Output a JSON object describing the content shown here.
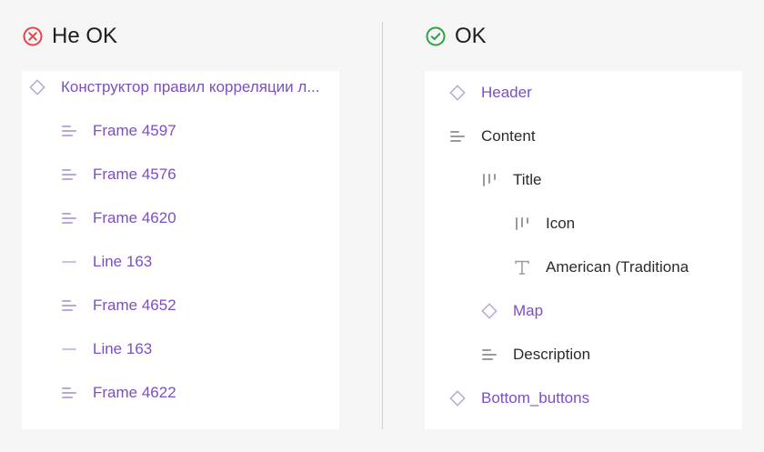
{
  "left": {
    "title": "Не OK",
    "status_color": "#e0474c",
    "items": [
      {
        "label": "Конструктор правил корреляции л...",
        "icon": "component-diamond-icon",
        "color": "purple"
      },
      {
        "label": "Frame 4597",
        "icon": "auto-layout-left-icon",
        "color": "purple"
      },
      {
        "label": "Frame 4576",
        "icon": "auto-layout-left-icon",
        "color": "purple"
      },
      {
        "label": "Frame 4620",
        "icon": "auto-layout-left-icon",
        "color": "purple"
      },
      {
        "label": "Line 163",
        "icon": "line-icon",
        "color": "purple"
      },
      {
        "label": "Frame 4652",
        "icon": "auto-layout-left-icon",
        "color": "purple"
      },
      {
        "label": "Line 163",
        "icon": "line-icon",
        "color": "purple"
      },
      {
        "label": "Frame 4622",
        "icon": "auto-layout-left-icon",
        "color": "purple"
      }
    ]
  },
  "right": {
    "title": "OK",
    "status_color": "#2fa043",
    "items": [
      {
        "label": "Header",
        "icon": "component-diamond-icon",
        "color": "purple"
      },
      {
        "label": "Content",
        "icon": "auto-layout-left-icon",
        "color": "dark"
      },
      {
        "label": "Title",
        "icon": "auto-layout-horizontal-icon",
        "color": "dark"
      },
      {
        "label": "Icon",
        "icon": "auto-layout-horizontal-icon",
        "color": "dark"
      },
      {
        "label": "American (Traditiona",
        "icon": "text-icon",
        "color": "dark"
      },
      {
        "label": "Map",
        "icon": "component-diamond-icon",
        "color": "purple"
      },
      {
        "label": "Description",
        "icon": "auto-layout-left-icon",
        "color": "dark"
      },
      {
        "label": "Bottom_buttons",
        "icon": "component-diamond-icon",
        "color": "purple"
      }
    ]
  },
  "colors": {
    "purple": "#7b4fc2",
    "dark": "#2b2b2b",
    "icon_purple": "#b9a7dd",
    "icon_gray": "#9a9a9a"
  }
}
